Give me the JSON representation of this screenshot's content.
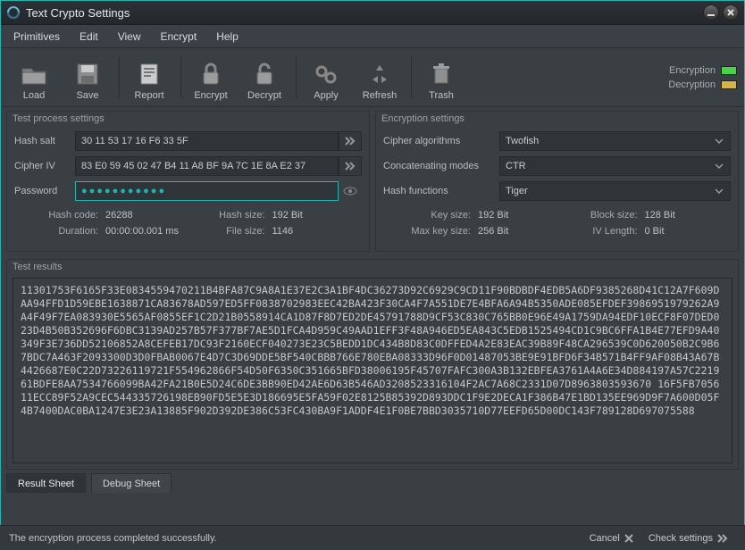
{
  "window": {
    "title": "Text Crypto Settings"
  },
  "menu": [
    "Primitives",
    "Edit",
    "View",
    "Encrypt",
    "Help"
  ],
  "toolbar": [
    {
      "name": "load",
      "label": "Load"
    },
    {
      "name": "save",
      "label": "Save"
    },
    {
      "name": "report",
      "label": "Report"
    },
    {
      "name": "encrypt",
      "label": "Encrypt"
    },
    {
      "name": "decrypt",
      "label": "Decrypt"
    },
    {
      "name": "apply",
      "label": "Apply"
    },
    {
      "name": "refresh",
      "label": "Refresh"
    },
    {
      "name": "trash",
      "label": "Trash"
    }
  ],
  "indicators": {
    "encryption_label": "Encryption",
    "encryption_color": "#4bd24b",
    "decryption_label": "Decryption",
    "decryption_color": "#d2b44b"
  },
  "test_process": {
    "title": "Test process settings",
    "hash_salt_label": "Hash salt",
    "hash_salt": "30 11 53 17 16 F6 33 5F",
    "cipher_iv_label": "Cipher IV",
    "cipher_iv": "83 E0 59 45 02 47 B4 11 A8 BF 9A 7C 1E 8A E2 37",
    "password_label": "Password",
    "password_mask": "●●●●●●●●●●●",
    "stats": {
      "hash_code_label": "Hash code:",
      "hash_code": "26288",
      "duration_label": "Duration:",
      "duration": "00:00:00.001 ms",
      "hash_size_label": "Hash size:",
      "hash_size": "192 Bit",
      "file_size_label": "File size:",
      "file_size": "1146"
    }
  },
  "encryption": {
    "title": "Encryption settings",
    "cipher_algorithms_label": "Cipher algorithms",
    "cipher_algorithms": "Twofish",
    "concatenating_modes_label": "Concatenating modes",
    "concatenating_modes": "CTR",
    "hash_functions_label": "Hash functions",
    "hash_functions": "Tiger",
    "stats": {
      "key_size_label": "Key size:",
      "key_size": "192 Bit",
      "max_key_size_label": "Max key size:",
      "max_key_size": "256 Bit",
      "block_size_label": "Block size:",
      "block_size": "128 Bit",
      "iv_length_label": "IV Length:",
      "iv_length": "0 Bit"
    }
  },
  "results": {
    "title": "Test results",
    "hex": "11301753F6165F33E0834559470211B4BFA87C9A8A1E37E2C3A1BF4DC36273D92C6929C9CD11F90BDBDF4EDB5A6DF9385268D41C12A7F609DAA94FFD1D59EBE1638871CA83678AD597ED5FF0838702983EEC42BA423F30CA4F7A551DE7E4BFA6A94B5350ADE085EFDEF3986951979262A9A4F49F7EA083930E5565AF0855EF1C2D21B0558914CA1D87F8D7ED2DE45791788D9CF53C830C765BB0E96E49A1759DA94EDF10ECF8F07DED023D4B50B352696F6DBC3139AD257B57F377BF7AE5D1FCA4D959C49AAD1EFF3F48A946ED5EA843C5EDB1525494CD1C9BC6FFA1B4E77EFD9A40349F3E736DD52106852A8CEFEB17DC93F2160ECF040273E23C5BEDD1DC434B8D83C0DFFED4A2E83EAC39B89F48CA296539C0D620050B2C9B67BDC7A463F2093300D3D0FBAB0067E4D7C3D69DDE5BF540CBBB766E780EBA08333D96F0D01487053BE9E91BFD6F34B571B4FF9AF08B43A67B4426687E0C22D73226119721F554962866F54D50F6350C351665BFD38006195F45707FAFC300A3B132EBFEA3761A4A6E34D884197A57C221961BDFE8AA7534766099BA42FA21B0E5D24C6DE3BB90ED42AE6D63B546AD3208523316104F2AC7A68C2331D07D8963803593670 16F5FB705611ECC89F52A9CEC544335726198EB90FD5E5E3D186695E5FA59F02E8125B85392D893DDC1F9E2DECA1F386B47E1BD135EE969D9F7A600D05F4B7400DAC0BA1247E3E23A13885F902D392DE386C53FC430BA9F1ADDF4E1F0BE7BBD3035710D77EEFD65D00DC143F789128D697075588"
  },
  "tabs": {
    "result_sheet": "Result Sheet",
    "debug_sheet": "Debug Sheet"
  },
  "footer": {
    "status": "The encryption process completed successfully.",
    "cancel": "Cancel",
    "check_settings": "Check settings"
  }
}
